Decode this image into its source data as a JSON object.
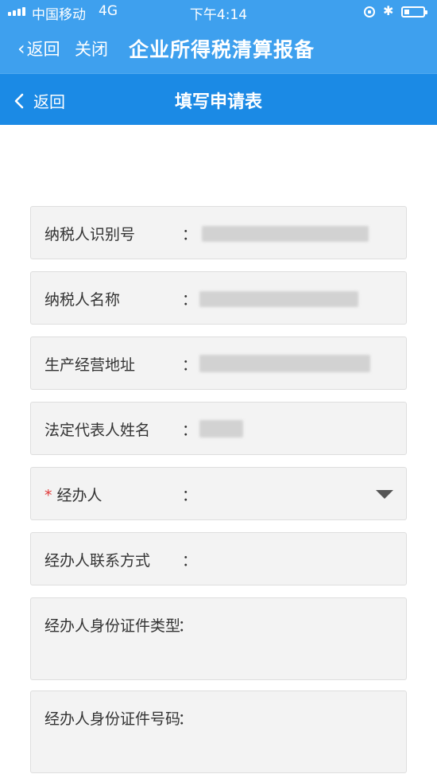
{
  "status_bar": {
    "carrier": "中国移动",
    "network": "4G",
    "time": "下午4:14",
    "bluetooth_glyph": "✱"
  },
  "app_header": {
    "back_label": "返回",
    "close_label": "关闭",
    "title": "企业所得税清算报备"
  },
  "nav_bar": {
    "back_label": "返回",
    "title": "填写申请表"
  },
  "form": {
    "colon": "：",
    "required_mark": "*",
    "fields": [
      {
        "label": "纳税人识别号"
      },
      {
        "label": "纳税人名称"
      },
      {
        "label": "生产经营地址"
      },
      {
        "label": "法定代表人姓名"
      },
      {
        "label": "经办人"
      },
      {
        "label": "经办人联系方式"
      },
      {
        "label": "经办人身份证件类型"
      },
      {
        "label": "经办人身份证件号码"
      }
    ]
  },
  "colors": {
    "header_blue": "#3ea0ee",
    "nav_blue": "#1b8ae5",
    "required_red": "#e03a3a",
    "field_bg": "#f3f3f3"
  },
  "icons": [
    "signal-icon",
    "lock-rotation-icon",
    "bluetooth-icon",
    "battery-icon",
    "chevron-left-icon",
    "dropdown-arrow-icon"
  ]
}
